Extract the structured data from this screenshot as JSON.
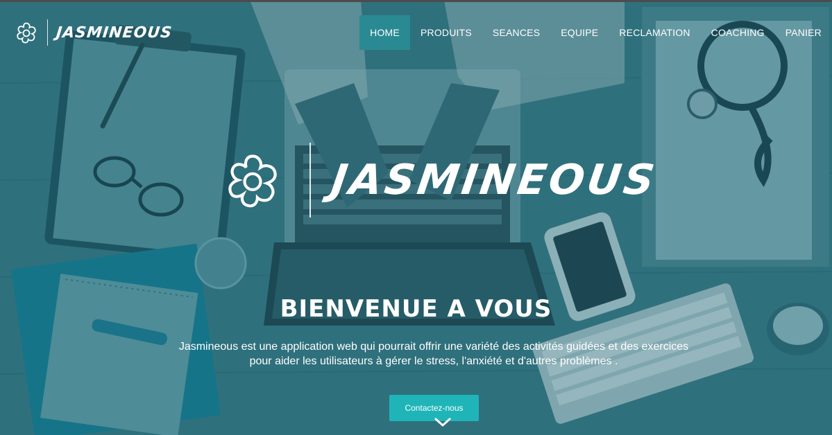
{
  "brand": {
    "name": "JASMINEOUS",
    "icon": "flower-icon"
  },
  "nav": {
    "items": [
      {
        "label": "HOME",
        "active": true
      },
      {
        "label": "PRODUITS"
      },
      {
        "label": "SEANCES"
      },
      {
        "label": "EQUIPE"
      },
      {
        "label": "RECLAMATION"
      },
      {
        "label": "COACHING"
      },
      {
        "label": "PANIER"
      }
    ]
  },
  "hero": {
    "logo_name": "JASMINEOUS",
    "title": "BIENVENUE A VOUS",
    "description_line1": "Jasmineous est une application web qui pourrait offrir une variété des activités guidées et des exercices",
    "description_line2": "pour aider les utilisateurs à gérer le stress, l'anxiété et d'autres problèmes .",
    "cta_label": "Contactez-nous",
    "scroll_icon": "chevron-down-icon"
  },
  "colors": {
    "accent": "#1fb5b8",
    "nav_active": "#2a8a93",
    "overlay": "#1b6270"
  }
}
